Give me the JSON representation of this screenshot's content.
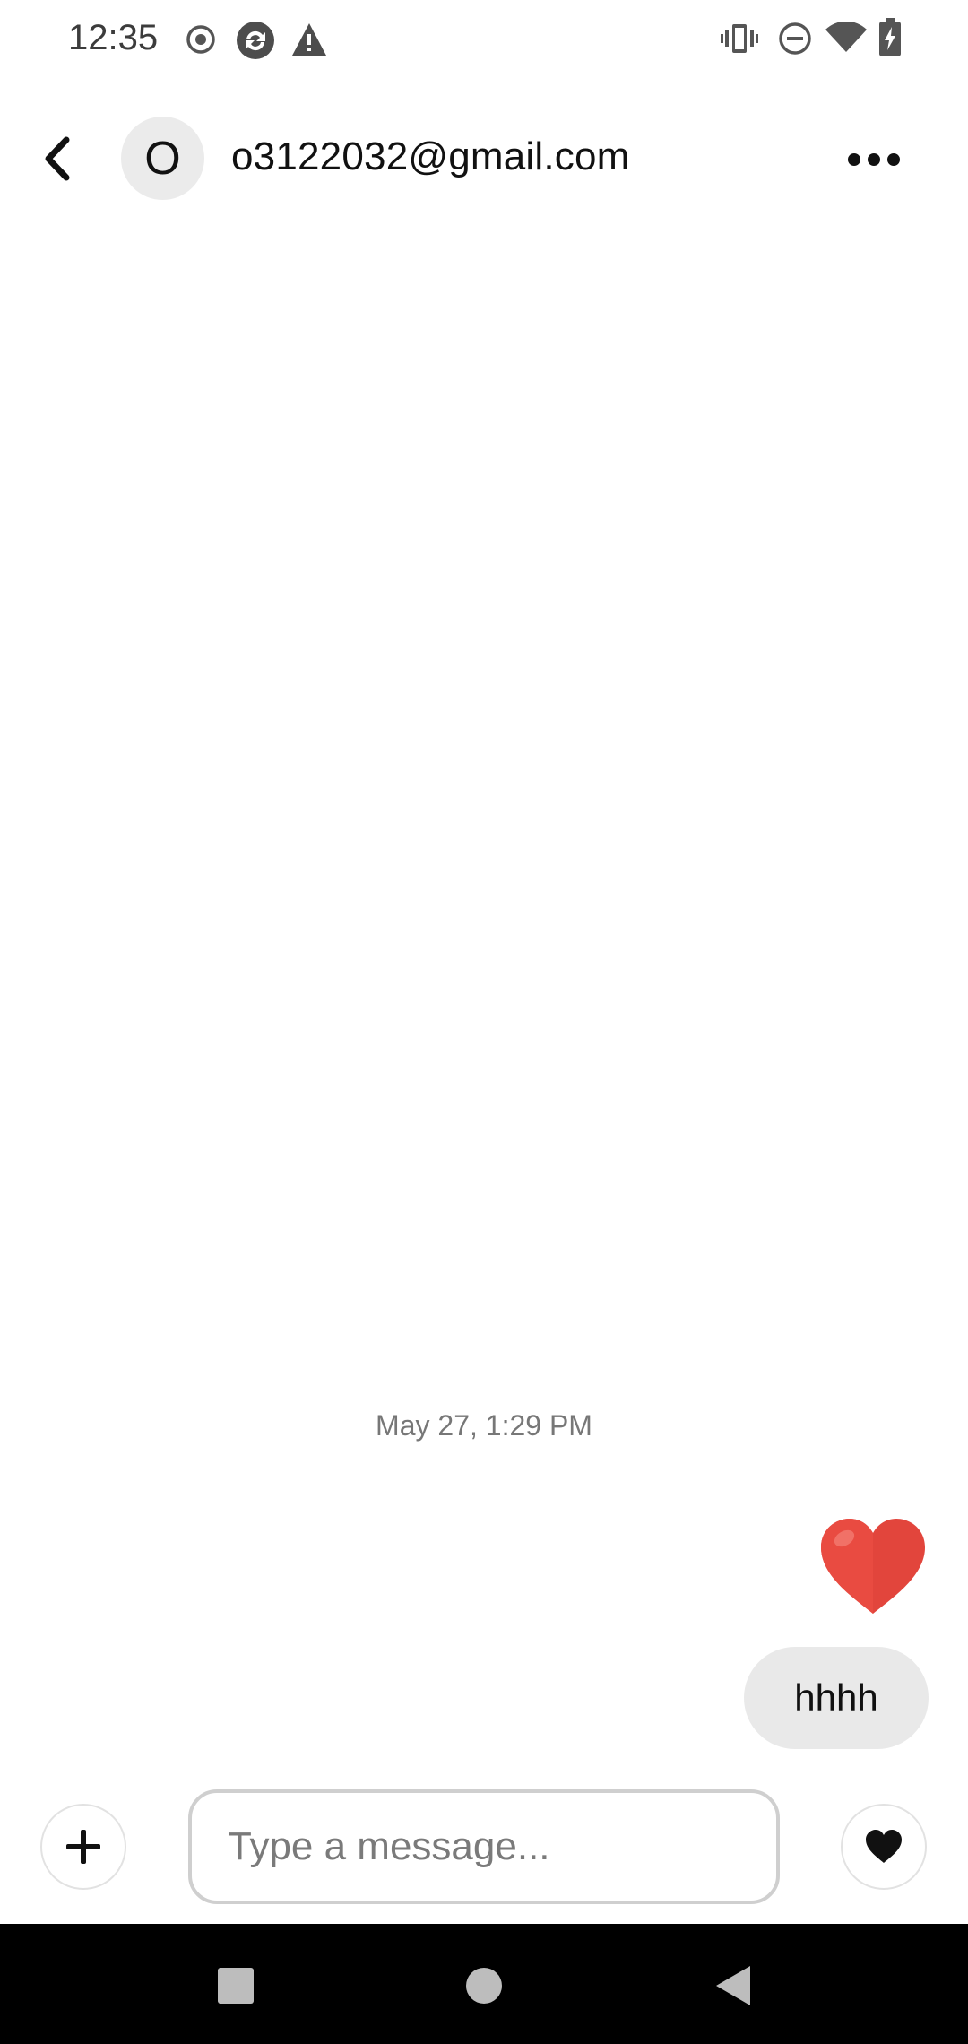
{
  "status_bar": {
    "time": "12:35",
    "left_icons": [
      "record-icon",
      "sync-icon",
      "warning-icon"
    ],
    "right_icons": [
      "vibrate-icon",
      "do-not-disturb-icon",
      "wifi-icon",
      "battery-charging-icon"
    ]
  },
  "header": {
    "avatar_initial": "O",
    "contact_name": "o3122032@gmail.com",
    "back_icon": "chevron-left-icon",
    "more_icon": "more-horizontal-icon"
  },
  "conversation": {
    "timestamp": "May 27, 1:29 PM",
    "messages": [
      {
        "type": "emoji",
        "content": "❤️",
        "icon": "red-heart-emoji"
      },
      {
        "type": "text",
        "content": "hhhh"
      }
    ]
  },
  "composer": {
    "placeholder": "Type a message...",
    "value": "",
    "add_icon": "plus-icon",
    "like_icon": "heart-icon"
  },
  "nav_bar": {
    "icons": [
      "recents-icon",
      "home-icon",
      "back-icon"
    ]
  },
  "colors": {
    "bubble": "#e9e9e9",
    "avatar_bg": "#ebebeb",
    "heart_red": "#e2453c",
    "nav_bg": "#000000"
  }
}
